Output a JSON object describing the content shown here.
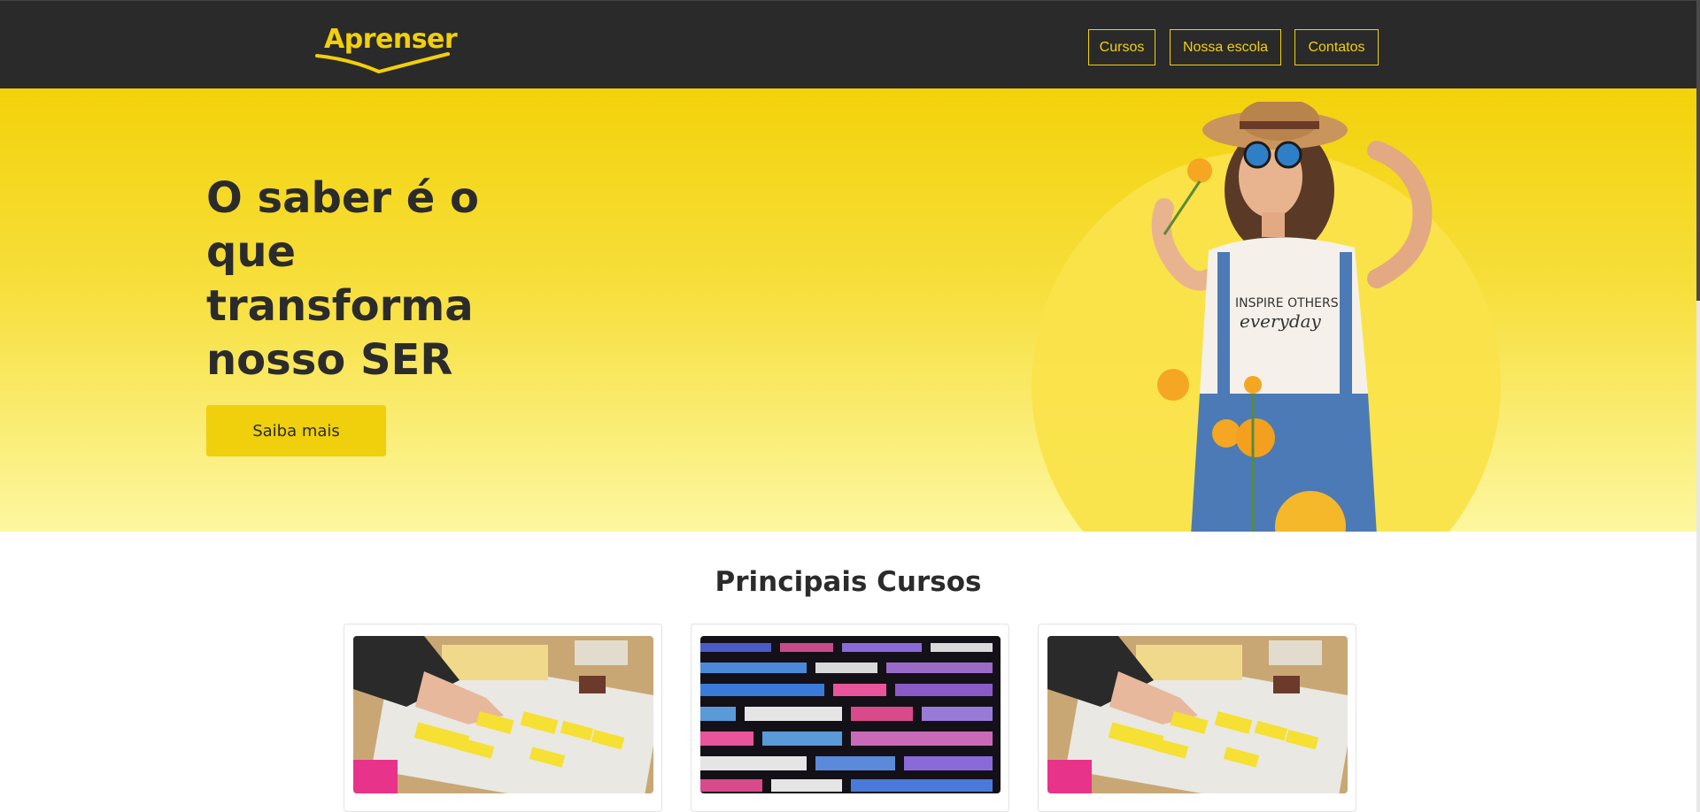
{
  "header": {
    "logo_text": "Aprenser",
    "nav": [
      {
        "label": "Cursos"
      },
      {
        "label": "Nossa escola"
      },
      {
        "label": "Contatos"
      }
    ]
  },
  "hero": {
    "title": "O saber é o que transforma nosso SER",
    "button_label": "Saiba mais",
    "shirt_text_line1": "INSPIRE OTHERS",
    "shirt_text_line2": "everyday"
  },
  "courses": {
    "title": "Principais Cursos",
    "cards": [
      {
        "image": "planning-sticky-notes-photo"
      },
      {
        "image": "code-screen-photo"
      },
      {
        "image": "planning-sticky-notes-photo"
      }
    ]
  },
  "colors": {
    "header_bg": "#2a2a2a",
    "accent_yellow": "#f2cf0b",
    "text_dark": "#2b2b2b"
  }
}
